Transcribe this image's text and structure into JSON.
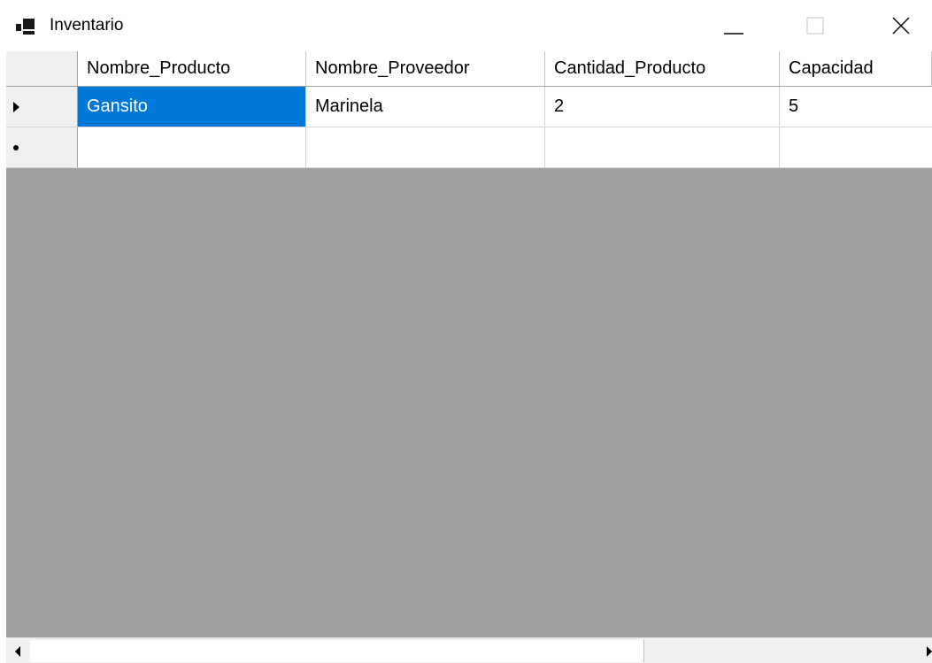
{
  "window": {
    "title": "Inventario"
  },
  "grid": {
    "columns": [
      "Nombre_Producto",
      "Nombre_Proveedor",
      "Cantidad_Producto",
      "Capacidad"
    ],
    "rows": [
      {
        "cells": [
          "Gansito",
          "Marinela",
          "2",
          "5"
        ],
        "indicator": "current-row-arrow-icon"
      }
    ],
    "new_row_indicator": "new-row-asterisk-icon",
    "selected_cell": {
      "row": 0,
      "column": 0
    }
  },
  "colors": {
    "selection": "#0078d7",
    "background": "#a0a0a0",
    "header": "#f0f0f0"
  }
}
